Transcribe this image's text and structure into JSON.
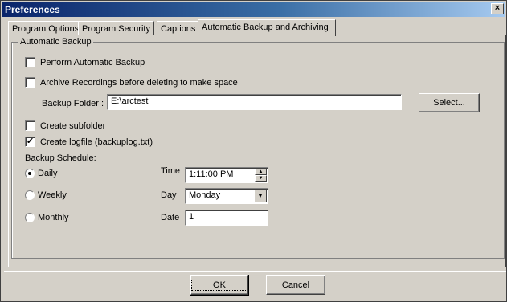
{
  "window": {
    "title": "Preferences",
    "close_glyph": "×"
  },
  "tabs": [
    {
      "label": "Program Options"
    },
    {
      "label": "Program Security"
    },
    {
      "label": "Captions"
    },
    {
      "label": "Automatic Backup and Archiving"
    }
  ],
  "backup": {
    "group_title": "Automatic Backup",
    "perform_label": "Perform Automatic Backup",
    "perform_checked": false,
    "archive_label": "Archive Recordings before  deleting to make space",
    "archive_checked": false,
    "folder_label": "Backup Folder :",
    "folder_value": "E:\\arctest",
    "select_label": "Select...",
    "subfolder_label": "Create subfolder",
    "subfolder_checked": false,
    "logfile_label": "Create logfile (backuplog.txt)",
    "logfile_checked": true,
    "check_glyph": "✔",
    "schedule_label": "Backup Schedule:",
    "daily_label": "Daily",
    "weekly_label": "Weekly",
    "monthly_label": "Monthly",
    "selected_schedule": "Daily",
    "time_label": "Time",
    "time_value": "1:11:00 PM",
    "day_label": "Day",
    "day_value": "Monday",
    "date_label": "Date",
    "date_value": "1",
    "spin_up": "▲",
    "spin_down": "▼",
    "dropdown_glyph": "▼"
  },
  "footer": {
    "ok_label": "OK",
    "cancel_label": "Cancel"
  }
}
